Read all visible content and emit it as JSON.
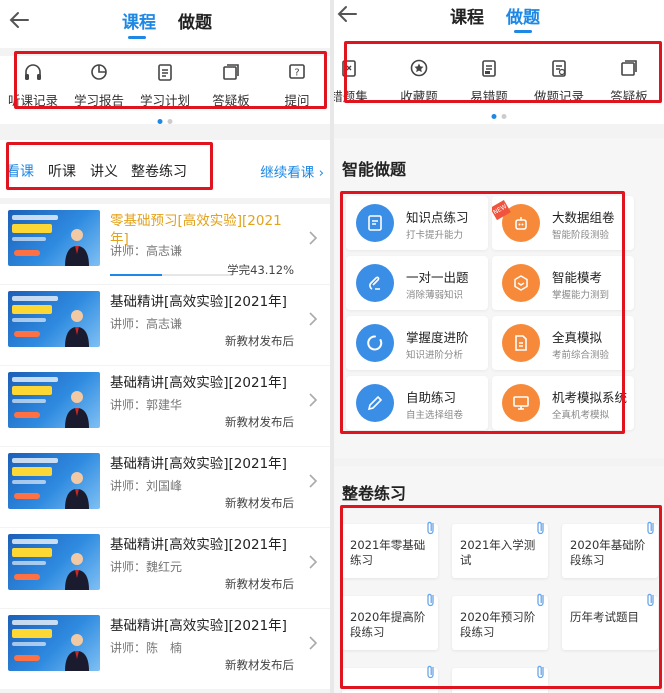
{
  "left": {
    "tabs": [
      {
        "label": "课程",
        "active": true
      },
      {
        "label": "做题",
        "active": false
      }
    ],
    "quick_icons": [
      {
        "label": "听课记录",
        "icon": "headphones-icon"
      },
      {
        "label": "学习报告",
        "icon": "report-icon"
      },
      {
        "label": "学习计划",
        "icon": "clipboard-icon"
      },
      {
        "label": "答疑板",
        "icon": "board-icon"
      },
      {
        "label": "提问",
        "icon": "question-icon"
      }
    ],
    "course_tabs": [
      {
        "label": "看课",
        "active": true
      },
      {
        "label": "听课"
      },
      {
        "label": "讲义"
      },
      {
        "label": "整卷练习"
      }
    ],
    "continue_label": "继续看课",
    "courses": [
      {
        "title": "零基础预习[高效实验][2021年]",
        "teacher": "讲师：高志谦",
        "status": "学完43.12%",
        "progress": 0.43,
        "highlight": true
      },
      {
        "title": "基础精讲[高效实验][2021年]",
        "teacher": "讲师：高志谦",
        "status": "新教材发布后"
      },
      {
        "title": "基础精讲[高效实验][2021年]",
        "teacher": "讲师：郭建华",
        "status": "新教材发布后"
      },
      {
        "title": "基础精讲[高效实验][2021年]",
        "teacher": "讲师：刘国峰",
        "status": "新教材发布后"
      },
      {
        "title": "基础精讲[高效实验][2021年]",
        "teacher": "讲师：魏红元",
        "status": "新教材发布后"
      },
      {
        "title": "基础精讲[高效实验][2021年]",
        "teacher": "讲师：陈　楠",
        "status": "新教材发布后"
      }
    ]
  },
  "right": {
    "tabs": [
      {
        "label": "课程",
        "active": false
      },
      {
        "label": "做题",
        "active": true
      }
    ],
    "quick_icons": [
      {
        "label": "错题集",
        "icon": "error-book-icon"
      },
      {
        "label": "收藏题",
        "icon": "star-icon"
      },
      {
        "label": "易错题",
        "icon": "doc-icon"
      },
      {
        "label": "做题记录",
        "icon": "record-icon"
      },
      {
        "label": "答疑板",
        "icon": "board-icon"
      }
    ],
    "smart_title": "智能做题",
    "smart_items": [
      {
        "title": "知识点练习",
        "sub": "打卡提升能力",
        "color": "blue",
        "icon": "note-icon"
      },
      {
        "title": "大数据组卷",
        "sub": "智能阶段测验",
        "color": "orange",
        "icon": "robot-icon",
        "badge": "NEW"
      },
      {
        "title": "一对一出题",
        "sub": "消除薄弱知识",
        "color": "blue",
        "icon": "pen-icon"
      },
      {
        "title": "智能模考",
        "sub": "掌握能力测到",
        "color": "orange",
        "icon": "cube-icon"
      },
      {
        "title": "掌握度进阶",
        "sub": "知识进阶分析",
        "color": "blue",
        "icon": "ring-icon"
      },
      {
        "title": "全真模拟",
        "sub": "考前综合测验",
        "color": "orange",
        "icon": "file-icon"
      },
      {
        "title": "自助练习",
        "sub": "自主选择组卷",
        "color": "blue",
        "icon": "pencil-icon"
      },
      {
        "title": "机考模拟系统",
        "sub": "全真机考模拟",
        "color": "orange",
        "icon": "monitor-icon"
      }
    ],
    "papers_title": "整卷练习",
    "papers": [
      "2021年零基础练习",
      "2021年入学测试",
      "2020年基础阶段练习",
      "2020年提高阶段练习",
      "2020年预习阶段练习",
      "历年考试题目",
      "",
      ""
    ],
    "colors": {
      "accent": "#1e88e5",
      "highlight": "#e3a21a",
      "frame": "#e0141e"
    }
  }
}
